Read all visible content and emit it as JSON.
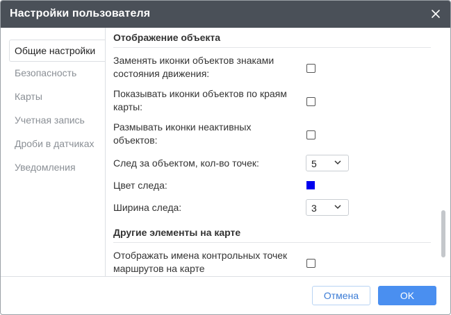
{
  "dialog": {
    "title": "Настройки пользователя",
    "close_icon": "close-icon"
  },
  "sidebar": {
    "items": [
      {
        "label": "Общие настройки",
        "active": true
      },
      {
        "label": "Безопасность"
      },
      {
        "label": "Карты"
      },
      {
        "label": "Учетная запись"
      },
      {
        "label": "Дроби в датчиках"
      },
      {
        "label": "Уведомления"
      }
    ]
  },
  "content": {
    "section_object": "Отображение объекта",
    "replace_icons": {
      "line1": "Заменять иконки объектов знаками",
      "line2": "состояния движения:",
      "checked": false
    },
    "edge_icons": {
      "line1": "Показывать иконки объектов по краям",
      "line2": "карты:",
      "checked": false
    },
    "blur_icons": {
      "line1": "Размывать иконки неактивных",
      "line2": "объектов:",
      "checked": false
    },
    "trail_points": {
      "label": "След за объектом, кол-во точек:",
      "value": "5"
    },
    "trail_color": {
      "label": "Цвет следа:",
      "color": "#0000ee"
    },
    "trail_width": {
      "label": "Ширина следа:",
      "value": "3"
    },
    "section_other": "Другие элементы на карте",
    "route_names": {
      "line1": "Отображать имена контрольных точек",
      "line2": "маршрутов на карте",
      "checked": false
    }
  },
  "footer": {
    "cancel_label": "Отмена",
    "ok_label": "OK"
  },
  "colors": {
    "titlebar": "#4a5058",
    "accent": "#4a8ff0"
  }
}
